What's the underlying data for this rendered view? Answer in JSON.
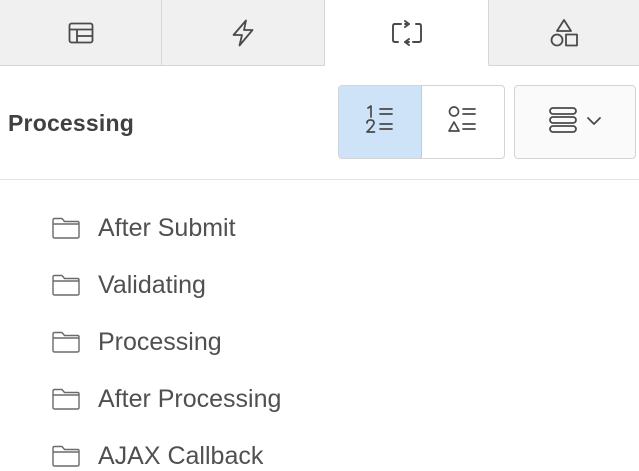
{
  "tabs": [
    {
      "icon": "layout-icon",
      "active": false
    },
    {
      "icon": "lightning-icon",
      "active": false
    },
    {
      "icon": "process-arrows-icon",
      "active": true
    },
    {
      "icon": "shapes-icon",
      "active": false
    }
  ],
  "toolbar": {
    "title": "Processing",
    "view_buttons": [
      {
        "icon": "numbered-list-icon",
        "active": true
      },
      {
        "icon": "shape-list-icon",
        "active": false
      }
    ],
    "menu_button": {
      "icon": "stack-menu-icon",
      "chevron": "chevron-down-icon"
    }
  },
  "tree": {
    "items": [
      {
        "icon": "folder-icon",
        "label": "After Submit"
      },
      {
        "icon": "folder-icon",
        "label": "Validating"
      },
      {
        "icon": "folder-icon",
        "label": "Processing"
      },
      {
        "icon": "folder-icon",
        "label": "After Processing"
      },
      {
        "icon": "folder-icon",
        "label": "AJAX Callback"
      }
    ]
  },
  "colors": {
    "accent_bg": "#cfe3f8",
    "tab_bg": "#f0f0f0",
    "text": "#404040",
    "icon": "#4a4a4a"
  }
}
